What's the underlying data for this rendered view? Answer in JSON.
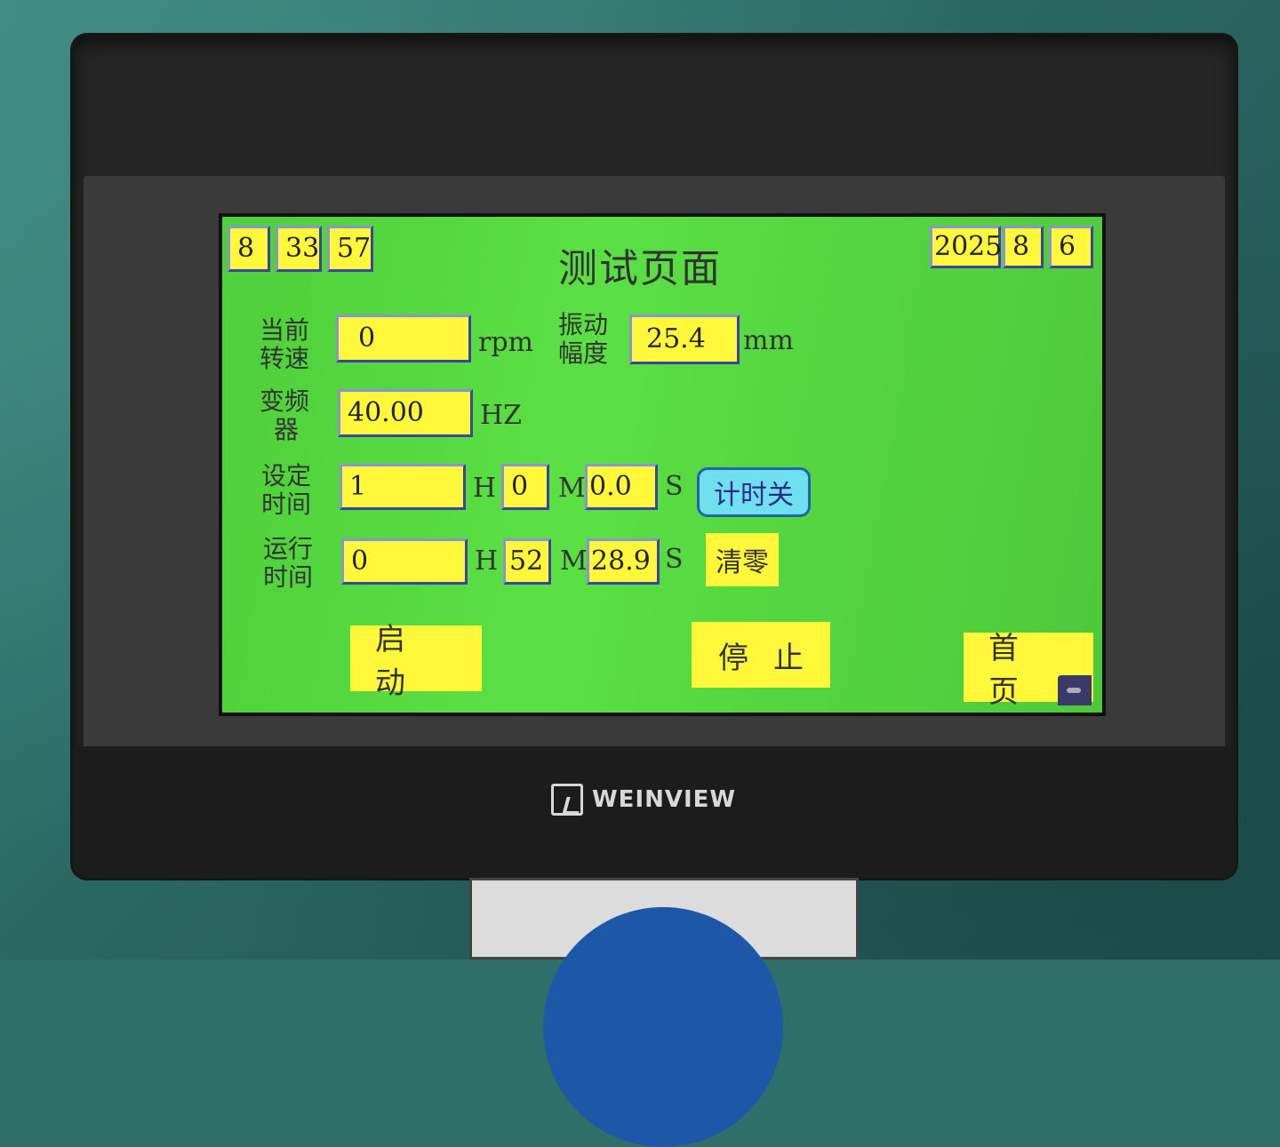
{
  "device": {
    "brand": "WEINVIEW"
  },
  "clock": {
    "hour": "8",
    "minute": "33",
    "second": "57"
  },
  "date": {
    "year": "2025",
    "month": "8",
    "day": "6"
  },
  "page_title": "测试页面",
  "speed": {
    "label_line1": "当前",
    "label_line2": "转速",
    "value": "0",
    "unit": "rpm"
  },
  "amplitude": {
    "label_line1": "振动",
    "label_line2": "幅度",
    "value": "25.4",
    "unit": "mm"
  },
  "inverter": {
    "label_line1": "变频",
    "label_line2": "器",
    "value": "40.00",
    "unit": "HZ"
  },
  "set_time": {
    "label_line1": "设定",
    "label_line2": "时间",
    "hours": "1",
    "minutes": "0",
    "seconds": "0.0",
    "h_unit": "H",
    "m_unit": "M",
    "s_unit": "S"
  },
  "run_time": {
    "label_line1": "运行",
    "label_line2": "时间",
    "hours": "0",
    "minutes": "52",
    "seconds": "28.9",
    "h_unit": "H",
    "m_unit": "M",
    "s_unit": "S"
  },
  "buttons": {
    "timer_off": "计时关",
    "clear": "清零",
    "start": "启动",
    "stop": "停止",
    "home": "首页"
  },
  "colors": {
    "screen": "#56d840",
    "field": "#fff83a",
    "field_border": "#3b45a0",
    "timer_button": "#6ee0ef"
  }
}
